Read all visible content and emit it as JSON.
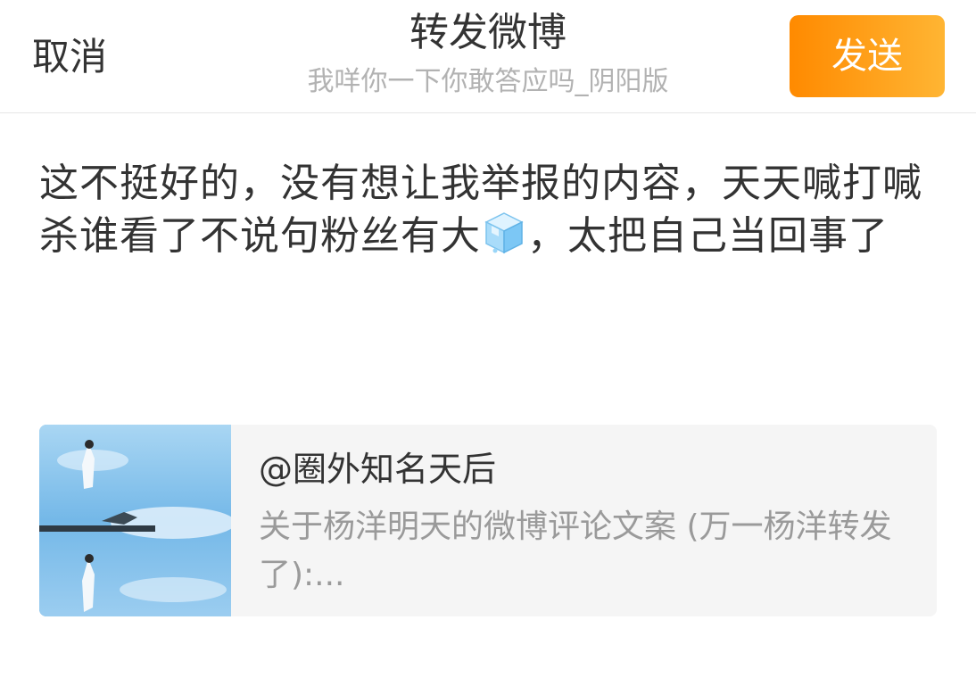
{
  "header": {
    "cancel_label": "取消",
    "title": "转发微博",
    "subtitle": "我咩你一下你敢答应吗_阴阳版",
    "send_label": "发送",
    "send_button_color_start": "#ff8a00",
    "send_button_color_end": "#ffb533"
  },
  "compose": {
    "text_before_emoji": "这不挺好的，没有想让我举报的内容，天天喊打喊杀谁看了不说句粉丝有大",
    "emoji": "ice-cube-emoji",
    "text_after_emoji": "，太把自己当回事了"
  },
  "quoted_post": {
    "author": "@圈外知名天后",
    "text": "关于杨洋明天的微博评论文案 (万一杨洋转发了):...",
    "thumbnail": "crane-sky-photo"
  }
}
